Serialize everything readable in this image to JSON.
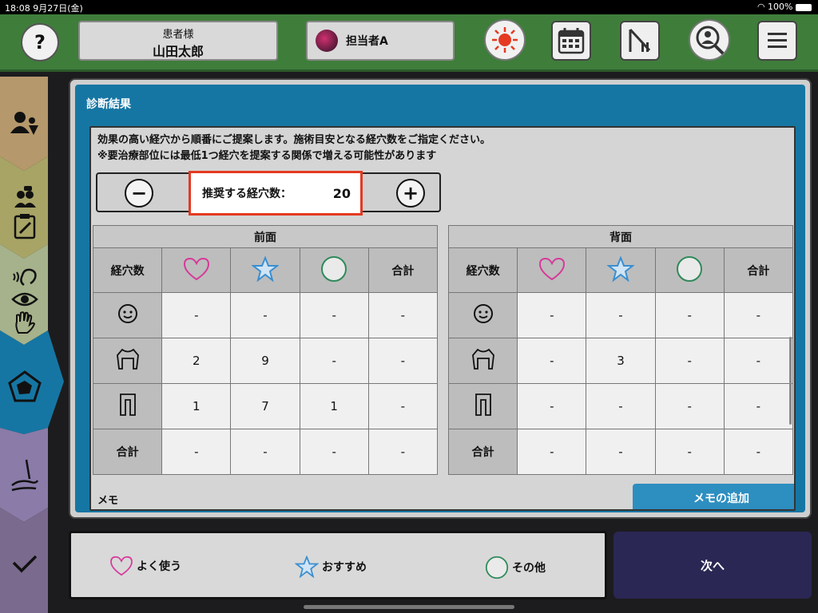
{
  "statusbar": {
    "time_date": "18:08  9月27日(金)",
    "battery": "100%"
  },
  "header": {
    "help_label": "?",
    "patient_label": "患者様",
    "patient_name": "山田太郎",
    "staff_name": "担当者A"
  },
  "panel": {
    "title": "診断結果",
    "instructions": [
      "効果の高い経穴から順番にご提案します。施術目安となる経穴数をご指定ください。",
      "※要治療部位には最低1つ経穴を提案する関係で増える可能性があります"
    ],
    "stepper": {
      "minus": "−",
      "plus": "+",
      "label": "推奨する経穴数：",
      "value": "20"
    }
  },
  "tables": {
    "row_header_label": "経穴数",
    "total_label": "合計",
    "front": {
      "title": "前面",
      "rows": [
        {
          "region": "face",
          "values": [
            "-",
            "-",
            "-",
            "-"
          ]
        },
        {
          "region": "upper-body",
          "values": [
            "2",
            "9",
            "-",
            "-"
          ]
        },
        {
          "region": "lower-body",
          "values": [
            "1",
            "7",
            "1",
            "-"
          ]
        },
        {
          "region": "total",
          "label": "合計",
          "values": [
            "-",
            "-",
            "-",
            "-"
          ]
        }
      ]
    },
    "back": {
      "title": "背面",
      "rows": [
        {
          "region": "face",
          "values": [
            "-",
            "-",
            "-",
            "-"
          ]
        },
        {
          "region": "upper-body",
          "values": [
            "-",
            "3",
            "-",
            "-"
          ]
        },
        {
          "region": "lower-body",
          "values": [
            "-",
            "-",
            "-",
            "-"
          ]
        },
        {
          "region": "total",
          "label": "合計",
          "values": [
            "-",
            "-",
            "-",
            "-"
          ]
        }
      ]
    }
  },
  "memo": {
    "label": "メモ",
    "add_button": "メモの追加"
  },
  "legend": {
    "frequent": "よく使う",
    "recommended": "おすすめ",
    "other": "その他"
  },
  "next_button": "次へ",
  "colors": {
    "header_green": "#3f7d3b",
    "panel_blue": "#1676a3",
    "heart": "#d63a9a",
    "star": "#3a8fd0",
    "circle": "#2f8a5a",
    "highlight": "#e53921",
    "next_bg": "#2a2754"
  }
}
